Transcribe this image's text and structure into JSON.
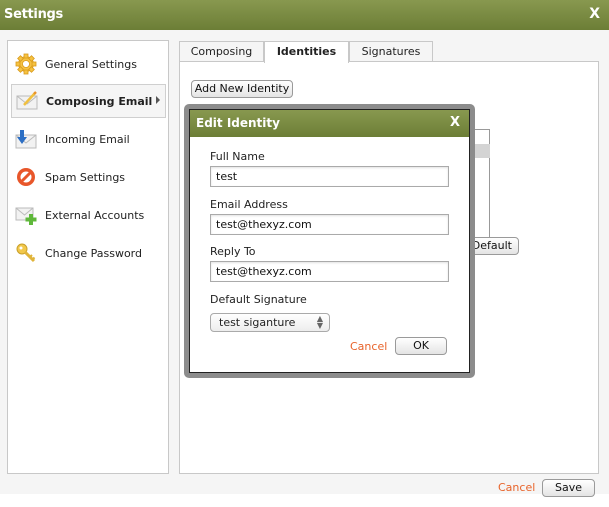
{
  "window": {
    "title": "Settings",
    "close_label": "X"
  },
  "sidebar": {
    "items": [
      {
        "label": "General Settings",
        "icon": "gear-icon",
        "active": false
      },
      {
        "label": "Composing Email",
        "icon": "compose-email-icon",
        "active": true
      },
      {
        "label": "Incoming Email",
        "icon": "incoming-email-icon",
        "active": false
      },
      {
        "label": "Spam Settings",
        "icon": "no-entry-icon",
        "active": false
      },
      {
        "label": "External Accounts",
        "icon": "add-account-icon",
        "active": false
      },
      {
        "label": "Change Password",
        "icon": "key-icon",
        "active": false
      }
    ]
  },
  "tabs": [
    {
      "label": "Composing",
      "active": false
    },
    {
      "label": "Identities",
      "active": true
    },
    {
      "label": "Signatures",
      "active": false
    }
  ],
  "identities": {
    "add_button": "Add New Identity",
    "set_default_button_visible": "s Default"
  },
  "dialog": {
    "title": "Edit Identity",
    "close_label": "X",
    "full_name_label": "Full Name",
    "full_name_value": "test",
    "email_label": "Email Address",
    "email_value": "test@thexyz.com",
    "reply_to_label": "Reply To",
    "reply_to_value": "test@thexyz.com",
    "signature_label": "Default Signature",
    "signature_value": "test siganture",
    "cancel_label": "Cancel",
    "ok_label": "OK"
  },
  "footer": {
    "cancel_label": "Cancel",
    "save_label": "Save"
  },
  "colors": {
    "header_green": "#7a8c42",
    "cancel_orange": "#e8632a"
  }
}
